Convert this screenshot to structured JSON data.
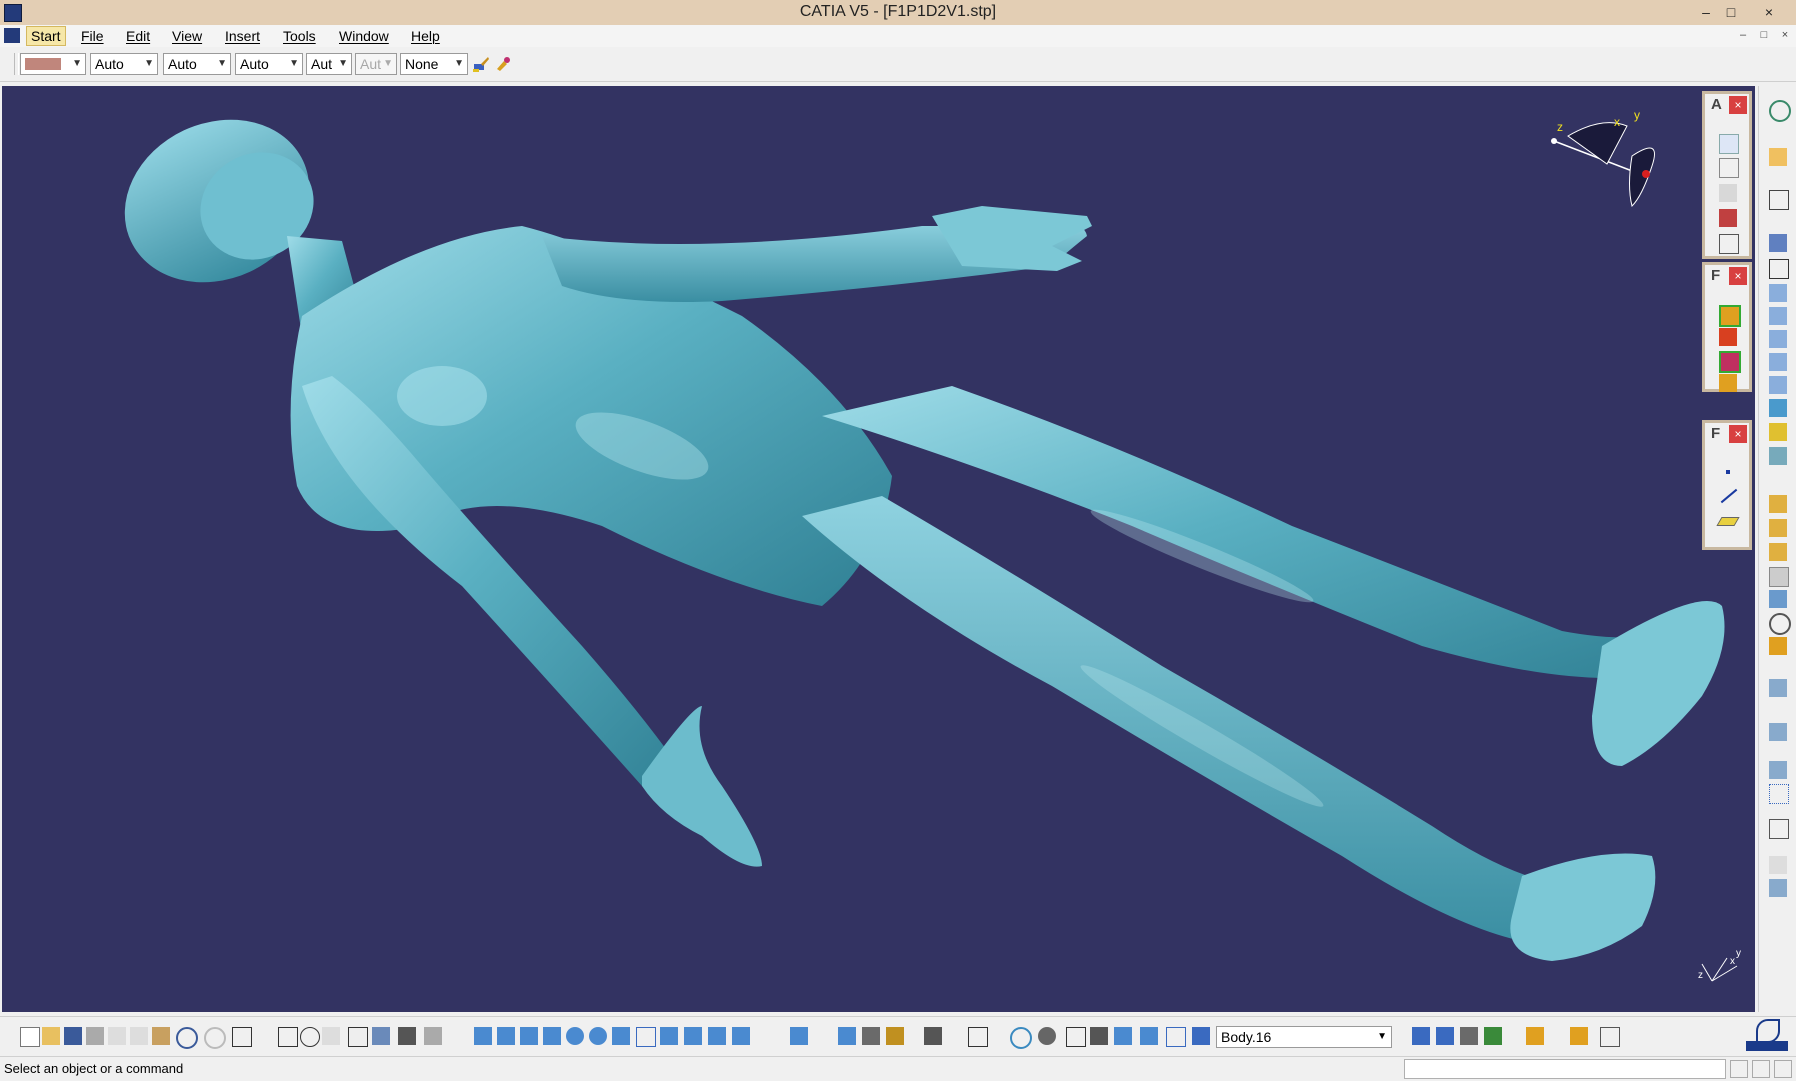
{
  "window": {
    "title": "CATIA V5 - [F1P1D2V1.stp]",
    "controls": [
      "–",
      "□",
      "×"
    ],
    "mdi_controls": [
      "–",
      "□",
      "×"
    ]
  },
  "menu": {
    "items": [
      "Start",
      "File",
      "Edit",
      "View",
      "Insert",
      "Tools",
      "Window",
      "Help"
    ]
  },
  "graphic_properties": {
    "fill_color": "#c0867c",
    "line_type": "Auto",
    "line_thickness": "Auto",
    "point_symbol": "Auto",
    "rendering_style": "Aut",
    "layer_disabled": "Aut",
    "layer": "None"
  },
  "palettes": {
    "annotations": {
      "title": "A",
      "close": "×"
    },
    "f_palette_1": {
      "title": "F",
      "close": "×"
    },
    "f_palette_2": {
      "title": "F",
      "close": "×"
    }
  },
  "compass": {
    "x": "x",
    "y": "y",
    "z": "z"
  },
  "mini_axis": {
    "x": "x",
    "y": "y",
    "z": "z"
  },
  "colors": {
    "viewport_bg": "#333362",
    "model": "#5aaabb",
    "titlebar": "#e3ceb4"
  },
  "bottom_toolbar": {
    "current_body": "Body.16"
  },
  "status": {
    "message": "Select an object or a command"
  }
}
